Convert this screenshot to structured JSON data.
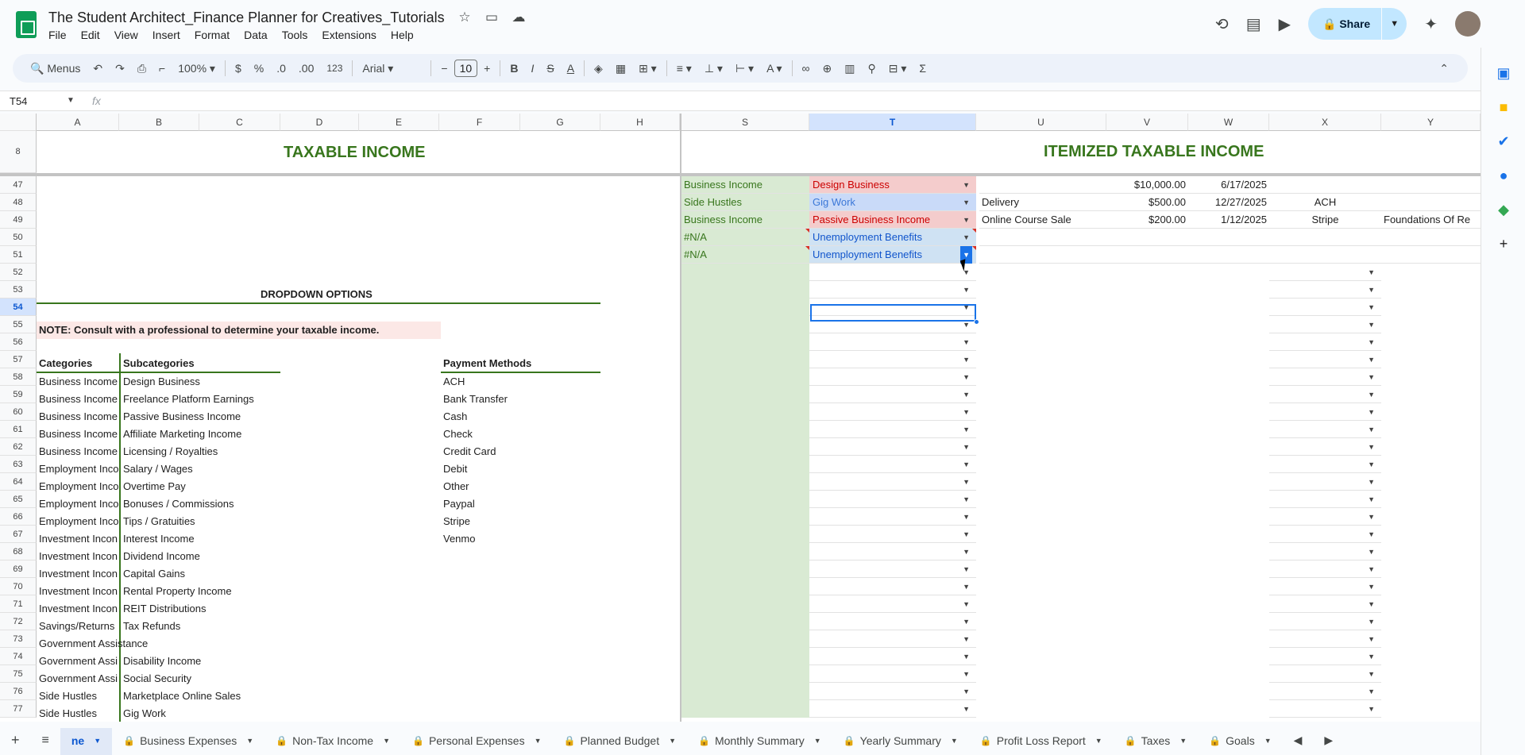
{
  "document": {
    "title": "The Student Architect_Finance Planner for Creatives_Tutorials"
  },
  "menu": [
    "File",
    "Edit",
    "View",
    "Insert",
    "Format",
    "Data",
    "Tools",
    "Extensions",
    "Help"
  ],
  "header_actions": {
    "share_label": "Share"
  },
  "toolbar": {
    "search_label": "Menus",
    "zoom": "100%",
    "currency": "$",
    "percent": "%",
    "dec_decrease": ".0",
    "dec_increase": ".00",
    "number_format": "123",
    "font": "Arial",
    "font_size": "10"
  },
  "formula_bar": {
    "name_box": "T54",
    "fx": "fx"
  },
  "columns_left": [
    "A",
    "B",
    "C",
    "D",
    "E",
    "F",
    "G",
    "H"
  ],
  "columns_right": [
    "S",
    "T",
    "U",
    "V",
    "W",
    "X",
    "Y"
  ],
  "frozen_row_label": "8",
  "titles": {
    "left": "TAXABLE INCOME",
    "right": "ITEMIZED TAXABLE INCOME"
  },
  "rows": [
    "47",
    "48",
    "49",
    "50",
    "51",
    "52",
    "53",
    "54",
    "55",
    "56",
    "57",
    "58",
    "59",
    "60",
    "61",
    "62",
    "63",
    "64",
    "65",
    "66",
    "67",
    "68",
    "69",
    "70",
    "71",
    "72",
    "73",
    "74",
    "75",
    "76",
    "77"
  ],
  "itemized_rows": [
    {
      "category": "Business Income",
      "subcategory": "Design Business",
      "description": "",
      "amount": "$10,000.00",
      "date": "6/17/2025",
      "method": "",
      "note": ""
    },
    {
      "category": "Side Hustles",
      "subcategory": "Gig Work",
      "description": "Delivery",
      "amount": "$500.00",
      "date": "12/27/2025",
      "method": "ACH",
      "note": ""
    },
    {
      "category": "Business Income",
      "subcategory": "Passive Business Income",
      "description": "Online Course Sale",
      "amount": "$200.00",
      "date": "1/12/2025",
      "method": "Stripe",
      "note": "Foundations Of Re"
    },
    {
      "category": "#N/A",
      "subcategory": "Unemployment Benefits",
      "description": "",
      "amount": "",
      "date": "",
      "method": "",
      "note": ""
    },
    {
      "category": "#N/A",
      "subcategory": "Unemployment Benefits",
      "description": "",
      "amount": "",
      "date": "",
      "method": "",
      "note": ""
    }
  ],
  "dropdown_section": {
    "title": "DROPDOWN OPTIONS",
    "note": "NOTE: Consult with a professional to determine your taxable income.",
    "categories_header": "Categories",
    "subcategories_header": "Subcategories",
    "payment_header": "Payment Methods",
    "categories": [
      "Business Income",
      "Business Income",
      "Business Income",
      "Business Income",
      "Business Income",
      "Employment Inco",
      "Employment Inco",
      "Employment Inco",
      "Employment Inco",
      "Investment Incon",
      "Investment Incon",
      "Investment Incon",
      "Investment Incon",
      "Investment Incon",
      "Savings/Returns",
      "Government Assistance",
      "Government Assi",
      "Government Assi",
      "Side Hustles",
      "Side Hustles"
    ],
    "subcategories": [
      "Design Business",
      "Freelance Platform Earnings",
      "Passive Business Income",
      "Affiliate Marketing Income",
      "Licensing / Royalties",
      "Salary / Wages",
      "Overtime Pay",
      "Bonuses / Commissions",
      "Tips / Gratuities",
      "Interest Income",
      "Dividend Income",
      "Capital Gains",
      "Rental Property Income",
      "REIT Distributions",
      "Tax Refunds",
      "",
      "Disability Income",
      "Social Security",
      "Marketplace Online Sales",
      "Gig Work"
    ],
    "payment_methods": [
      "ACH",
      "Bank Transfer",
      "Cash",
      "Check",
      "Credit Card",
      "Debit",
      "Other",
      "Paypal",
      "Stripe",
      "Venmo"
    ]
  },
  "tabs": [
    {
      "label": "ne",
      "locked": false,
      "active": true
    },
    {
      "label": "Business Expenses",
      "locked": true,
      "active": false
    },
    {
      "label": "Non-Tax Income",
      "locked": true,
      "active": false
    },
    {
      "label": "Personal Expenses",
      "locked": true,
      "active": false
    },
    {
      "label": "Planned Budget",
      "locked": true,
      "active": false
    },
    {
      "label": "Monthly Summary",
      "locked": true,
      "active": false
    },
    {
      "label": "Yearly Summary",
      "locked": true,
      "active": false
    },
    {
      "label": "Profit Loss Report",
      "locked": true,
      "active": false
    },
    {
      "label": "Taxes",
      "locked": true,
      "active": false
    },
    {
      "label": "Goals",
      "locked": true,
      "active": false
    }
  ],
  "colors": {
    "accent": "#0b57d0",
    "title_green": "#38761d",
    "green_fill": "#d9ead3",
    "pink_fill": "#f4cccc",
    "blue_fill": "#cfe2f3"
  }
}
